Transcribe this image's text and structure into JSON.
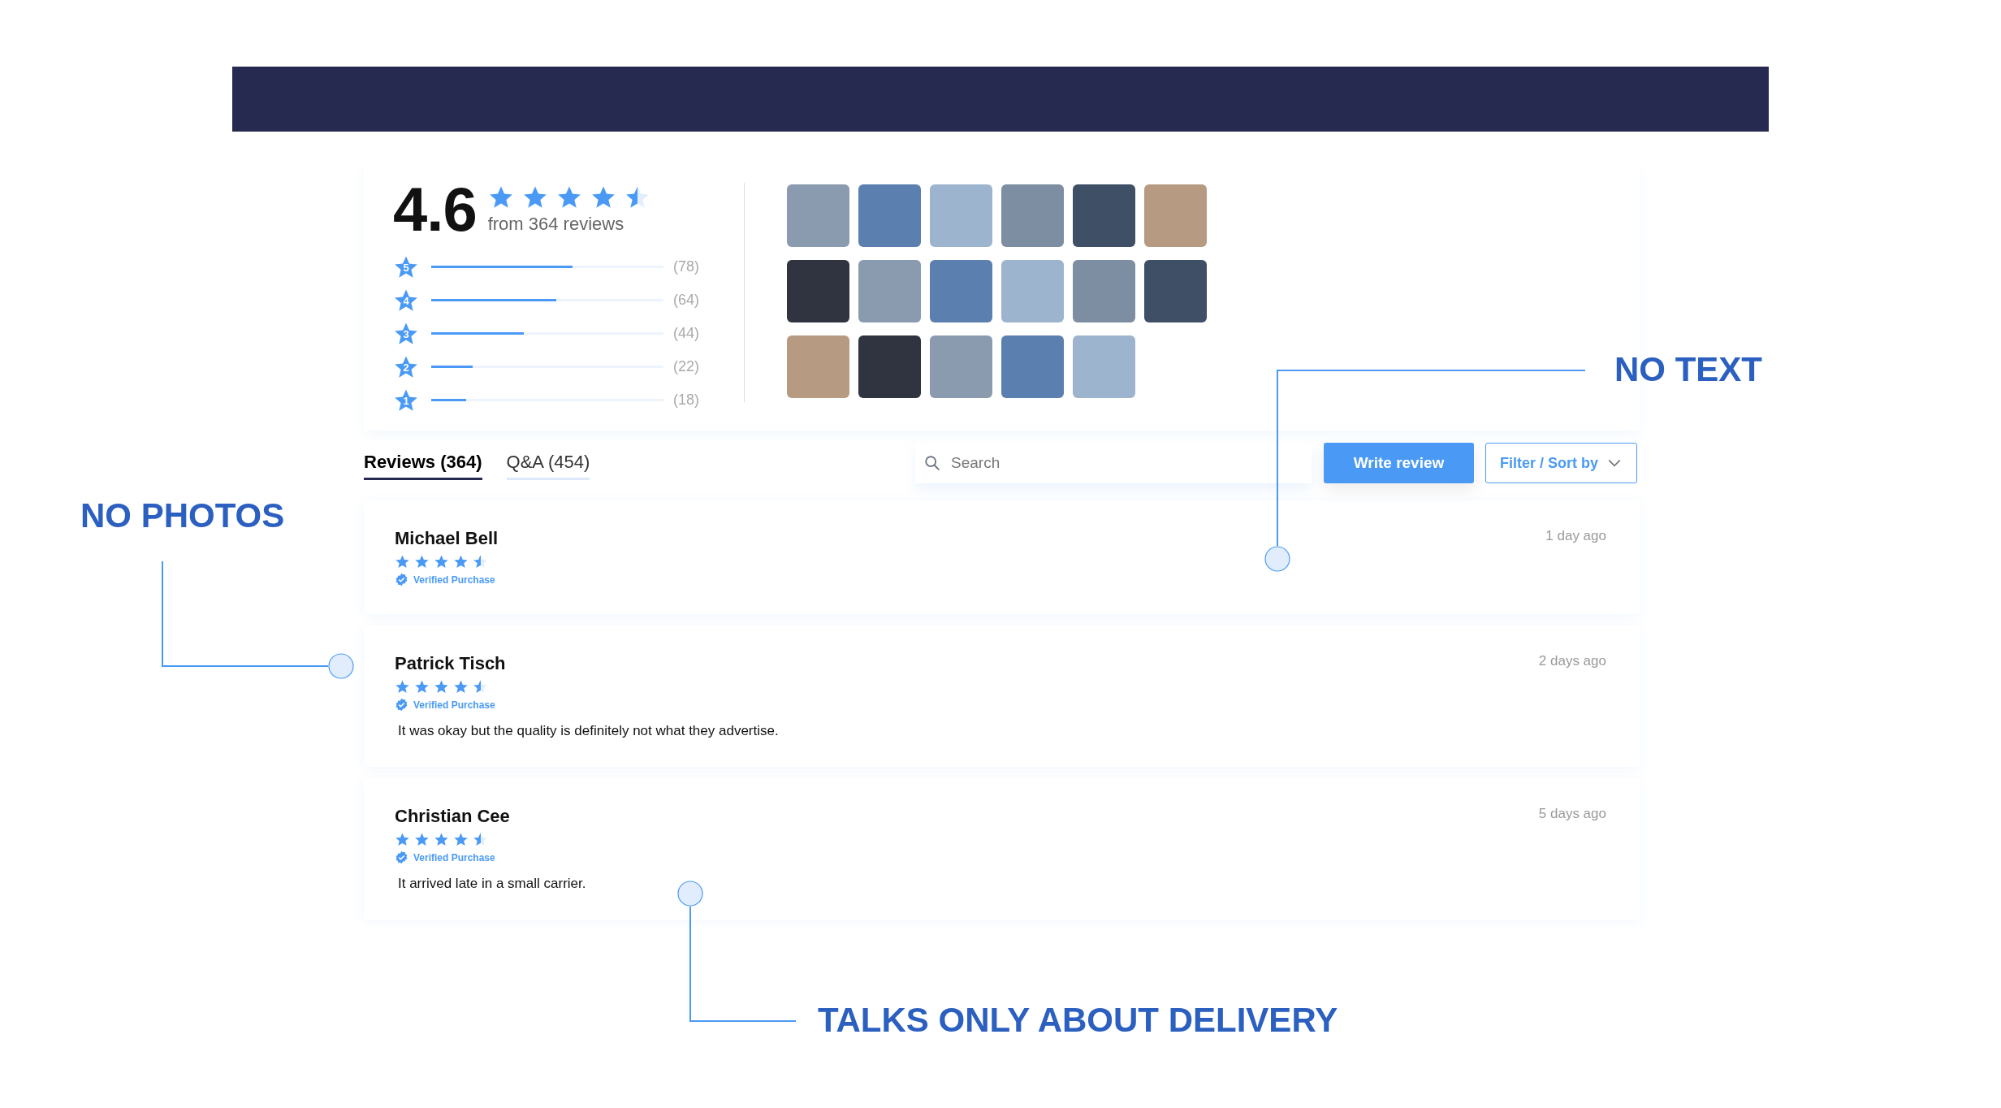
{
  "summary": {
    "rating": "4.6",
    "stars": 4.5,
    "review_count": "from 364 reviews",
    "bars": [
      {
        "star": "5",
        "level": 0.61,
        "count": "(78)"
      },
      {
        "star": "4",
        "level": 0.54,
        "count": "(64)"
      },
      {
        "star": "3",
        "level": 0.4,
        "count": "(44)"
      },
      {
        "star": "2",
        "level": 0.18,
        "count": "(22)"
      },
      {
        "star": "1",
        "level": 0.15,
        "count": "(18)"
      }
    ],
    "photo_rows": [
      [
        {
          "kind": "photo"
        },
        {
          "kind": "photo"
        },
        {
          "kind": "photo"
        },
        {
          "kind": "photo"
        },
        {
          "kind": "photo"
        },
        {
          "kind": "photo"
        }
      ],
      [
        {
          "kind": "photo"
        },
        {
          "kind": "photo"
        },
        {
          "kind": "photo"
        },
        {
          "kind": "photo"
        },
        {
          "kind": "photo"
        },
        {
          "kind": "photo"
        }
      ],
      [
        {
          "kind": "photo"
        },
        {
          "kind": "photo"
        },
        {
          "kind": "photo"
        },
        {
          "kind": "photo"
        },
        {
          "kind": "photo"
        }
      ]
    ]
  },
  "tabs": [
    {
      "label": "Reviews (364)",
      "selected": true
    },
    {
      "label": "Q&A (454)",
      "selected": false
    }
  ],
  "search": {
    "placeholder": "Search"
  },
  "buttons": {
    "write": "Write review",
    "filter": "Filter / Sort by"
  },
  "reviews": [
    {
      "name": "Michael Bell",
      "stars": 4.5,
      "verified": "Verified Purchase",
      "time": "1 day ago"
    },
    {
      "name": "Patrick Tisch",
      "stars": 4.5,
      "verified": "Verified Purchase",
      "time": "2 days ago",
      "text": "It was okay but the quality is definitely not what they advertise."
    },
    {
      "name": "Christian Cee",
      "stars": 4.5,
      "verified": "Verified Purchase",
      "time": "5 days ago",
      "text": "It arrived late in a small carrier."
    }
  ],
  "annotations": [
    {
      "label": "NO TEXT"
    },
    {
      "label": "NO PHOTOS"
    },
    {
      "label": "TALKS ONLY ABOUT DELIVERY"
    }
  ]
}
